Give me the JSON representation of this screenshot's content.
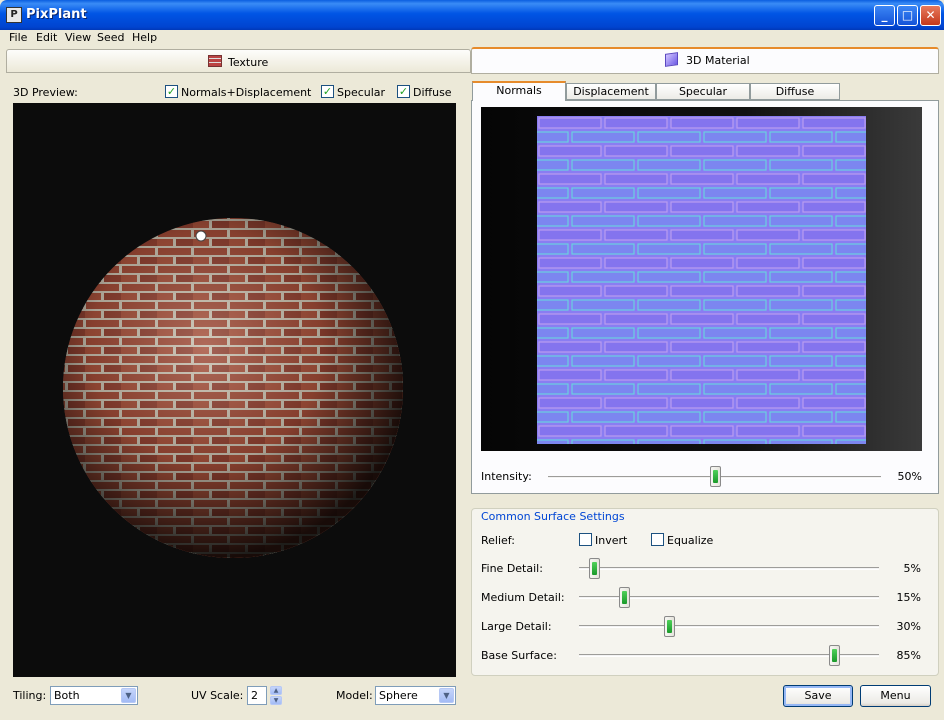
{
  "window": {
    "title": "PixPlant",
    "icon_text": "P",
    "minimize": "_",
    "maximize": "□",
    "close": "✕"
  },
  "menu": [
    "File",
    "Edit",
    "View",
    "Seed",
    "Help"
  ],
  "left": {
    "tab_label": "Texture",
    "preview_label": "3D Preview:",
    "checks": [
      {
        "label": "Normals+Displacement",
        "checked": true
      },
      {
        "label": "Specular",
        "checked": true
      },
      {
        "label": "Diffuse",
        "checked": true
      }
    ],
    "tiling_label": "Tiling:",
    "tiling_value": "Both",
    "uvscale_label": "UV Scale:",
    "uvscale_value": "2",
    "model_label": "Model:",
    "model_value": "Sphere"
  },
  "right": {
    "tab_label": "3D Material",
    "subtabs": [
      "Normals",
      "Displacement",
      "Specular",
      "Diffuse"
    ],
    "active_subtab": "Normals",
    "intensity": {
      "label": "Intensity:",
      "value": "50%",
      "fraction": 0.5
    },
    "common_title": "Common Surface Settings",
    "relief_label": "Relief:",
    "invert_label": "Invert",
    "invert_checked": false,
    "equalize_label": "Equalize",
    "equalize_checked": false,
    "sliders": [
      {
        "label": "Fine Detail:",
        "value": "5%",
        "fraction": 0.05
      },
      {
        "label": "Medium Detail:",
        "value": "15%",
        "fraction": 0.15
      },
      {
        "label": "Large Detail:",
        "value": "30%",
        "fraction": 0.3
      },
      {
        "label": "Base Surface:",
        "value": "85%",
        "fraction": 0.85
      }
    ],
    "save_label": "Save",
    "menu_label": "Menu"
  },
  "colors": {
    "titlebar": "#0055e5",
    "accent_tab": "#e68b2c",
    "group_title": "#0046d5",
    "brick": "#9e4a36",
    "normal_map": "#8b7cf0"
  }
}
